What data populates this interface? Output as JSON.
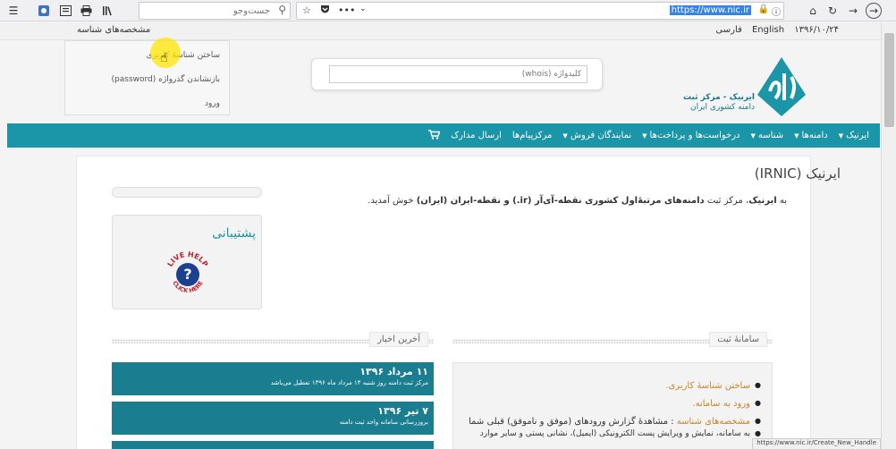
{
  "browser": {
    "search_placeholder": "جست‌وجو",
    "url": "https://www.nic.ir"
  },
  "site": {
    "top_bar": {
      "date": "۱۳۹۶/۱۰/۲۴",
      "lang_en": "English",
      "lang_fa": "فارسی",
      "shenase_label": "مشخصه‌های شناسه"
    },
    "account_menu": [
      {
        "label": "ساختن شناسهٔ کاربری"
      },
      {
        "label": "بازنشاندن گذرواژه (password)"
      },
      {
        "label": "ورود"
      }
    ],
    "whois_placeholder": "کلیدواژه (whois)",
    "logo_text": {
      "line1": "ایرنیک - مرکز ثبت",
      "line2": "دامنه کشوری ایران"
    },
    "nav": [
      {
        "label": "ایرنیک",
        "caret": true
      },
      {
        "label": "دامنه‌ها",
        "caret": true
      },
      {
        "label": "شناسه",
        "caret": true
      },
      {
        "label": "درخواست‌ها و پرداخت‌ها",
        "caret": true
      },
      {
        "label": "نمایندگان فروش",
        "caret": true
      },
      {
        "label": "مرکزپیام‌ها",
        "caret": false
      },
      {
        "label": "ارسال مدارک",
        "caret": false
      }
    ],
    "page_title": "ایرنیک (IRNIC)",
    "welcome": {
      "pre": "به ",
      "brand": "ایرنیک",
      "mid": "، مرکز ثبت ",
      "bold": "دامنه‌های مرتبهٔ‌اول کشوری نقطه-آی‌آر (ir.) و نقطه-ایران (ایران)",
      "post": " خوش آمدید."
    },
    "support_title": "پشتیبانی",
    "livehelp": {
      "top": "LIVE HELP",
      "bottom": "CLICK HERE"
    },
    "news_heading": "آخرین اخبار",
    "news": [
      {
        "date": "۱۱ مرداد ۱۳۹۶",
        "text": "مرکز ثبت دامنه روز شنبه ۱۴ مرداد ماه ۱۳۹۶ تعطیل می‌باشد"
      },
      {
        "date": "۷ تیر ۱۳۹۶",
        "text": "بروزرسانی سامانه واحد ثبت دامنه"
      }
    ],
    "reg_heading": "سامانهٔ ثبت",
    "reg_items": [
      {
        "link": "ساختن شناسهٔ کاربری."
      },
      {
        "link": "ورود به سامانه."
      },
      {
        "link": "مشخصه‌های شناسه",
        "text": " : مشاهدهٔ گزارش ورودهای (موفق و ناموفق) قبلی شما",
        "sub": "به سامانه، نمایش و ویرایش پست الکترونیکی (ایمیل)، نشانی پستی و سایر موارد"
      }
    ],
    "status_url": "https://www.nic.ir/Create_New_Handle"
  }
}
